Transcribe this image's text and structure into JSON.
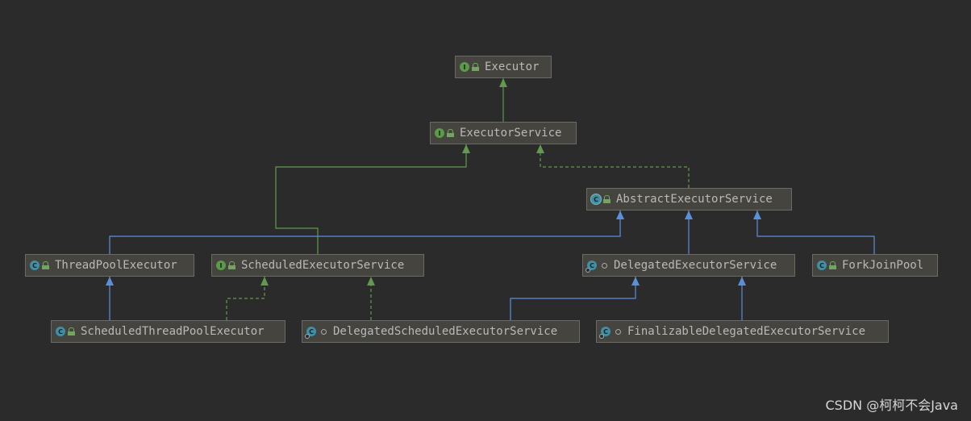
{
  "diagram": {
    "colors": {
      "background": "#2b2b2b",
      "implements_edge": "#5f9a4e",
      "extends_edge": "#5b8fd9"
    },
    "nodes": [
      {
        "id": "executor",
        "label": "Executor",
        "kind": "interface",
        "icon": "interface-icon"
      },
      {
        "id": "executor_service",
        "label": "ExecutorService",
        "kind": "interface",
        "icon": "interface-icon"
      },
      {
        "id": "abstract_executor_service",
        "label": "AbstractExecutorService",
        "kind": "abstract-class",
        "icon": "abstract-class-icon"
      },
      {
        "id": "thread_pool_executor",
        "label": "ThreadPoolExecutor",
        "kind": "class",
        "icon": "class-icon"
      },
      {
        "id": "scheduled_executor_service",
        "label": "ScheduledExecutorService",
        "kind": "interface",
        "icon": "interface-icon"
      },
      {
        "id": "delegated_executor_service",
        "label": "DelegatedExecutorService",
        "kind": "class",
        "icon": "class-icon"
      },
      {
        "id": "fork_join_pool",
        "label": "ForkJoinPool",
        "kind": "class",
        "icon": "class-icon"
      },
      {
        "id": "scheduled_thread_pool_executor",
        "label": "ScheduledThreadPoolExecutor",
        "kind": "class",
        "icon": "class-icon"
      },
      {
        "id": "delegated_scheduled_executor_service",
        "label": "DelegatedScheduledExecutorService",
        "kind": "class",
        "icon": "class-icon"
      },
      {
        "id": "finalizable_delegated_executor_service",
        "label": "FinalizableDelegatedExecutorService",
        "kind": "class",
        "icon": "class-icon"
      }
    ],
    "edges": [
      {
        "from": "executor_service",
        "to": "executor",
        "type": "extends-interface"
      },
      {
        "from": "scheduled_executor_service",
        "to": "executor_service",
        "type": "extends-interface"
      },
      {
        "from": "abstract_executor_service",
        "to": "executor_service",
        "type": "implements"
      },
      {
        "from": "thread_pool_executor",
        "to": "abstract_executor_service",
        "type": "extends"
      },
      {
        "from": "delegated_executor_service",
        "to": "abstract_executor_service",
        "type": "extends"
      },
      {
        "from": "fork_join_pool",
        "to": "abstract_executor_service",
        "type": "extends"
      },
      {
        "from": "scheduled_thread_pool_executor",
        "to": "thread_pool_executor",
        "type": "extends"
      },
      {
        "from": "scheduled_thread_pool_executor",
        "to": "scheduled_executor_service",
        "type": "implements"
      },
      {
        "from": "delegated_scheduled_executor_service",
        "to": "scheduled_executor_service",
        "type": "implements"
      },
      {
        "from": "delegated_scheduled_executor_service",
        "to": "delegated_executor_service",
        "type": "extends"
      },
      {
        "from": "finalizable_delegated_executor_service",
        "to": "delegated_executor_service",
        "type": "extends"
      }
    ]
  },
  "watermark": "CSDN @柯柯不会Java"
}
